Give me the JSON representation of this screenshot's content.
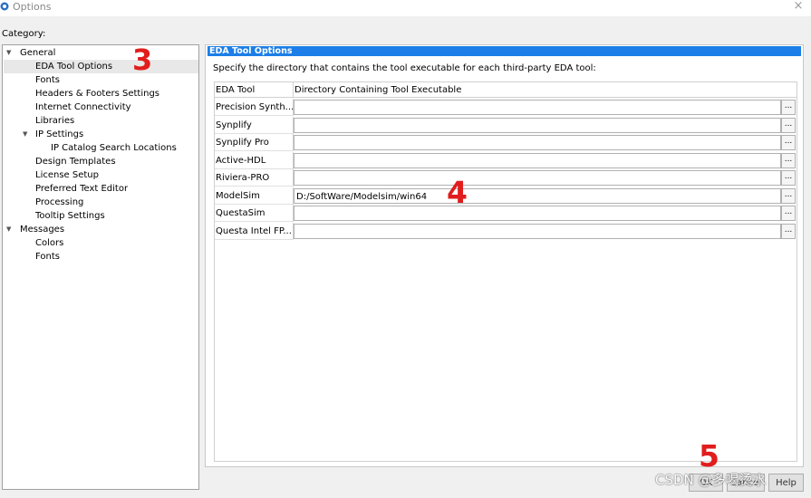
{
  "window": {
    "title": "Options",
    "close_glyph": "×"
  },
  "category_label": "Category:",
  "tree": [
    {
      "label": "General",
      "expanded": true
    },
    {
      "label": "EDA Tool Options",
      "selected": true
    },
    {
      "label": "Fonts"
    },
    {
      "label": "Headers & Footers Settings"
    },
    {
      "label": "Internet Connectivity"
    },
    {
      "label": "Libraries"
    },
    {
      "label": "IP Settings",
      "expanded": true
    },
    {
      "label": "IP Catalog Search Locations"
    },
    {
      "label": "Design Templates"
    },
    {
      "label": "License Setup"
    },
    {
      "label": "Preferred Text Editor"
    },
    {
      "label": "Processing"
    },
    {
      "label": "Tooltip Settings"
    },
    {
      "label": "Messages",
      "expanded": true
    },
    {
      "label": "Colors"
    },
    {
      "label": "Fonts"
    }
  ],
  "panel": {
    "header": "EDA Tool Options",
    "description": "Specify the directory that contains the tool executable for each third-party EDA tool:",
    "columns": [
      "EDA Tool",
      "Directory Containing Tool Executable"
    ],
    "browse_label": "...",
    "rows": [
      {
        "tool": "Precision Synth...",
        "dir": ""
      },
      {
        "tool": "Synplify",
        "dir": ""
      },
      {
        "tool": "Synplify Pro",
        "dir": ""
      },
      {
        "tool": "Active-HDL",
        "dir": ""
      },
      {
        "tool": "Riviera-PRO",
        "dir": ""
      },
      {
        "tool": "ModelSim",
        "dir": "D:/SoftWare/Modelsim/win64"
      },
      {
        "tool": "QuestaSim",
        "dir": ""
      },
      {
        "tool": "Questa Intel FP...",
        "dir": ""
      }
    ]
  },
  "annotations": [
    "3",
    "4",
    "5"
  ],
  "buttons": {
    "ok": "OK",
    "cancel": "Cancel",
    "help": "Help"
  },
  "watermark": "CSDN @多喝烫水",
  "colors": {
    "header_blue": "#1c7ee6",
    "annotation_red": "#e11d1d"
  }
}
